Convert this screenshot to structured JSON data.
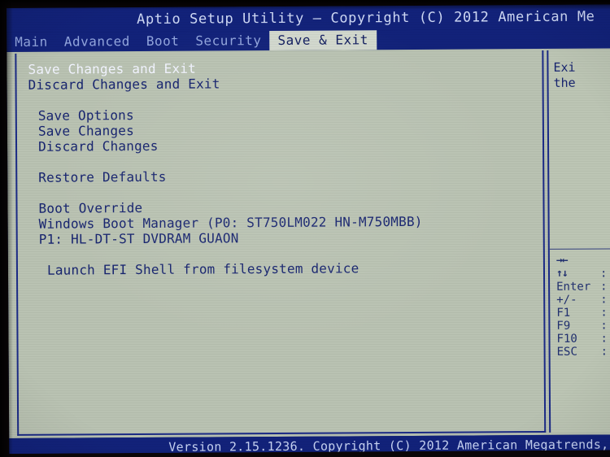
{
  "window": {
    "title": "Aptio Setup Utility – Copyright (C) 2012 American Me",
    "version_bar": "Version 2.15.1236. Copyright (C) 2012 American Megatrends,"
  },
  "menubar": {
    "tabs": [
      {
        "label": "Main",
        "active": false
      },
      {
        "label": "Advanced",
        "active": false
      },
      {
        "label": "Boot",
        "active": false
      },
      {
        "label": "Security",
        "active": false
      },
      {
        "label": "Save & Exit",
        "active": true
      }
    ]
  },
  "main": {
    "items": [
      {
        "label": "Save Changes and Exit",
        "indent": 0,
        "selected": true
      },
      {
        "label": "Discard Changes and Exit",
        "indent": 0,
        "selected": false
      },
      {
        "label": "",
        "indent": 0,
        "selected": false
      },
      {
        "label": "Save Options",
        "indent": 1,
        "selected": false
      },
      {
        "label": "Save Changes",
        "indent": 1,
        "selected": false
      },
      {
        "label": "Discard Changes",
        "indent": 1,
        "selected": false
      },
      {
        "label": "",
        "indent": 0,
        "selected": false
      },
      {
        "label": "Restore Defaults",
        "indent": 1,
        "selected": false
      },
      {
        "label": "",
        "indent": 0,
        "selected": false
      },
      {
        "label": "Boot Override",
        "indent": 1,
        "selected": false
      },
      {
        "label": "Windows Boot Manager (P0: ST750LM022 HN-M750MBB)",
        "indent": 1,
        "selected": false
      },
      {
        "label": "P1: HL-DT-ST DVDRAM GUAON",
        "indent": 1,
        "selected": false
      },
      {
        "label": "",
        "indent": 0,
        "selected": false
      },
      {
        "label": "Launch EFI Shell from filesystem device",
        "indent": 2,
        "selected": false
      }
    ]
  },
  "help": {
    "lines": [
      "Exi",
      "the"
    ]
  },
  "legend": {
    "keys": [
      {
        "name": "→←",
        "colon": "",
        "arrow": true
      },
      {
        "name": "↑↓",
        "colon": ":",
        "arrow": true
      },
      {
        "name": "Enter",
        "colon": ":",
        "arrow": false
      },
      {
        "name": "+/-",
        "colon": ":",
        "arrow": false
      },
      {
        "name": "F1",
        "colon": ":",
        "arrow": false
      },
      {
        "name": "F9",
        "colon": ":",
        "arrow": false
      },
      {
        "name": "F10",
        "colon": ":",
        "arrow": false
      },
      {
        "name": "ESC",
        "colon": ":",
        "arrow": false
      }
    ]
  },
  "colors": {
    "bios_blue": "#12227a",
    "panel_bg": "#b9c2b2",
    "text_blue": "#17246f",
    "selected_text": "#f2f4ff",
    "tab_active_bg": "#d2d8cd"
  }
}
